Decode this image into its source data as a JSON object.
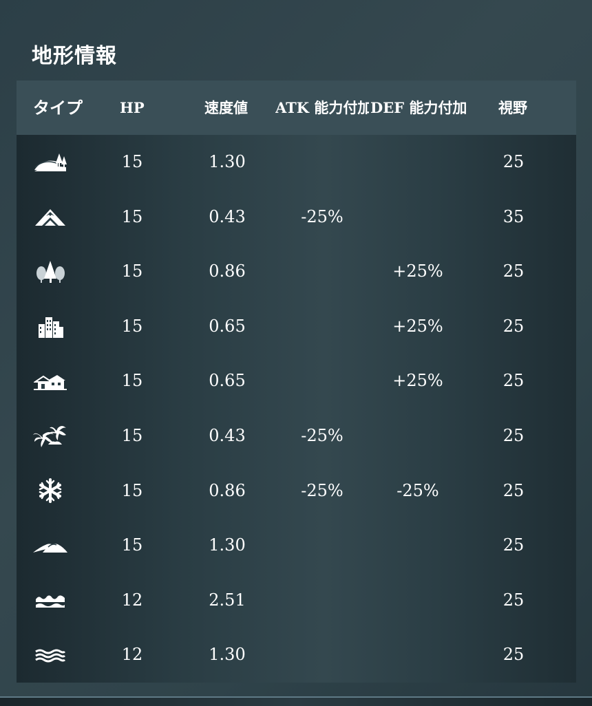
{
  "panel": {
    "title": "地形情報"
  },
  "table": {
    "headers": {
      "type": "タイプ",
      "hp": "HP",
      "speed": "速度値",
      "atk": "ATK 能力付加",
      "def": "DEF 能力付加",
      "view": "視野"
    },
    "rows": [
      {
        "icon": "plains-icon",
        "hp": "15",
        "speed": "1.30",
        "atk": "",
        "def": "",
        "view": "25"
      },
      {
        "icon": "mountain-icon",
        "hp": "15",
        "speed": "0.43",
        "atk": "-25%",
        "def": "",
        "view": "35"
      },
      {
        "icon": "forest-icon",
        "hp": "15",
        "speed": "0.86",
        "atk": "",
        "def": "+25%",
        "view": "25"
      },
      {
        "icon": "city-icon",
        "hp": "15",
        "speed": "0.65",
        "atk": "",
        "def": "+25%",
        "view": "25"
      },
      {
        "icon": "village-icon",
        "hp": "15",
        "speed": "0.65",
        "atk": "",
        "def": "+25%",
        "view": "25"
      },
      {
        "icon": "jungle-icon",
        "hp": "15",
        "speed": "0.43",
        "atk": "-25%",
        "def": "",
        "view": "25"
      },
      {
        "icon": "snow-icon",
        "hp": "15",
        "speed": "0.86",
        "atk": "-25%",
        "def": "-25%",
        "view": "25"
      },
      {
        "icon": "desert-icon",
        "hp": "15",
        "speed": "1.30",
        "atk": "",
        "def": "",
        "view": "25"
      },
      {
        "icon": "sea-icon",
        "hp": "12",
        "speed": "2.51",
        "atk": "",
        "def": "",
        "view": "25"
      },
      {
        "icon": "shallow-water-icon",
        "hp": "12",
        "speed": "1.30",
        "atk": "",
        "def": "",
        "view": "25"
      }
    ]
  }
}
